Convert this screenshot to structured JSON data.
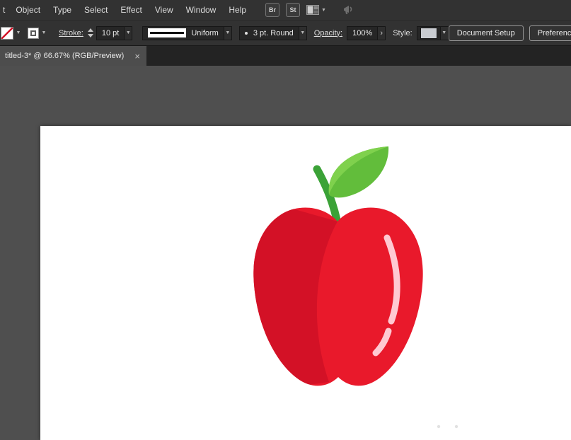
{
  "menubar": {
    "items": [
      {
        "label": "t"
      },
      {
        "label": "Object"
      },
      {
        "label": "Type"
      },
      {
        "label": "Select"
      },
      {
        "label": "Effect"
      },
      {
        "label": "View"
      },
      {
        "label": "Window"
      },
      {
        "label": "Help"
      }
    ],
    "bridge_badge": "Br",
    "stock_badge": "St"
  },
  "controlbar": {
    "stroke_label": "Stroke:",
    "stroke_weight": "10 pt",
    "profile": "Uniform",
    "brush": "3 pt. Round",
    "opacity_label": "Opacity:",
    "opacity_value": "100%",
    "opacity_arrow": "›",
    "style_label": "Style:",
    "document_setup_button": "Document Setup",
    "preferences_button": "Preferences"
  },
  "tabbar": {
    "title": "titled-3* @ 66.67% (RGB/Preview)",
    "close": "×"
  },
  "canvas": {
    "zoom_level": "66.67%",
    "color_mode": "RGB/Preview",
    "apple": {
      "body_color": "#e9192b",
      "shade_color": "#d31126",
      "highlight_color": "#ffc9d2",
      "stem_color": "#3ba237",
      "leaf_color": "#62bd3b",
      "leaf_light_color": "#7fd14d"
    }
  },
  "colors": {
    "panel_bg": "#323232",
    "tabbar_bg": "#232323",
    "tab_bg": "#4d4d4d",
    "canvas_bg": "#4f4f4f",
    "artboard_bg": "#ffffff"
  }
}
